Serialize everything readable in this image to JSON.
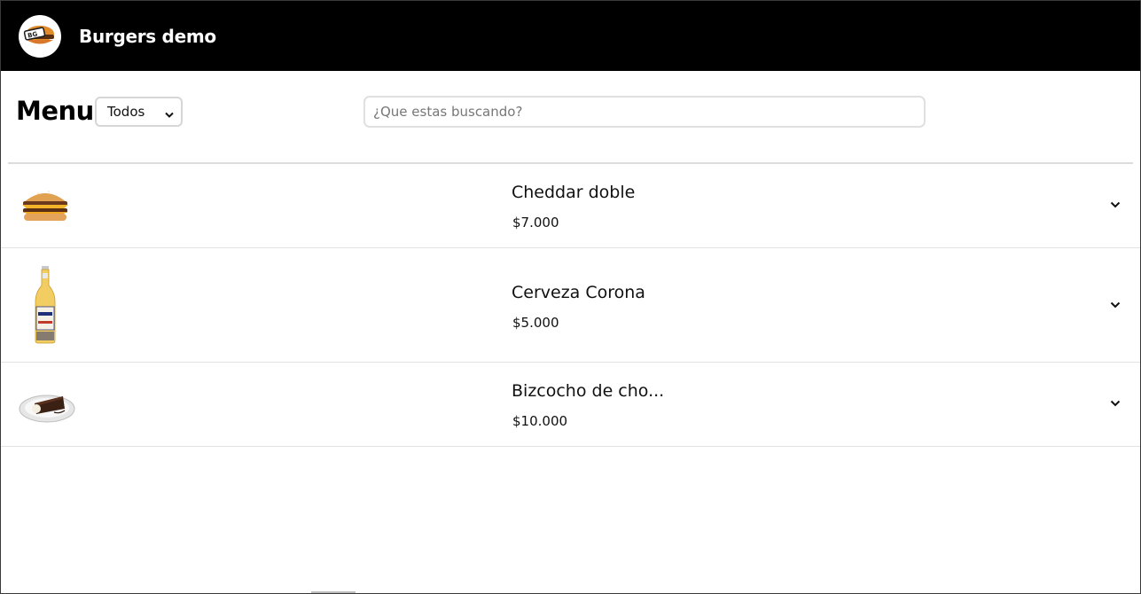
{
  "header": {
    "logo_icon": "burger-logo-icon",
    "title": "Burgers demo"
  },
  "toolbar": {
    "heading": "Menu",
    "category_select": {
      "selected": "Todos"
    },
    "search": {
      "value": "",
      "placeholder": "¿Que estas buscando?"
    }
  },
  "products": [
    {
      "name": "Cheddar doble",
      "price": "$7.000",
      "image_icon": "cheeseburger-image"
    },
    {
      "name": "Cerveza Corona",
      "price": "$5.000",
      "image_icon": "beer-bottle-image"
    },
    {
      "name": "Bizcocho de cho...",
      "price": "$10.000",
      "image_icon": "cake-slice-image"
    }
  ],
  "colors": {
    "header_bg": "#000000",
    "header_text": "#ffffff",
    "border": "#e2e2e2"
  }
}
